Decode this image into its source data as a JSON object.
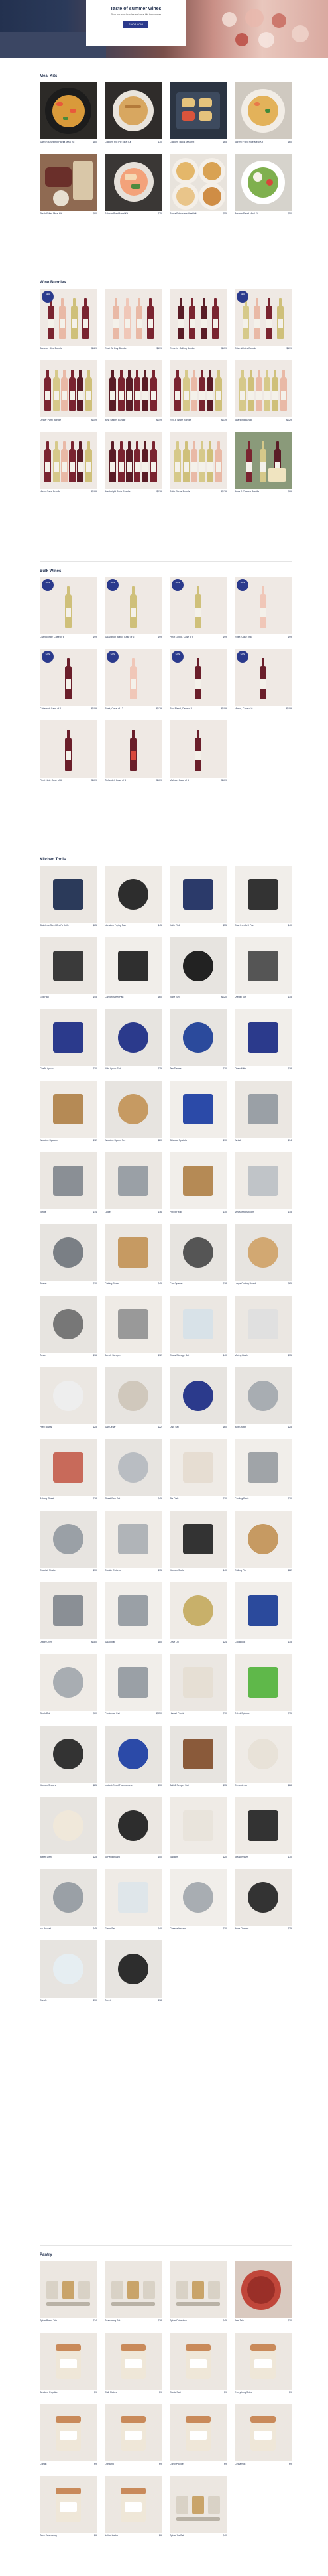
{
  "hero": {
    "title": "Taste of summer wines",
    "subtitle": "Shop our wine bundles and meal kits for summer",
    "button": "SHOP NOW"
  },
  "sections": [
    {
      "title": "Meal Kits",
      "items": [
        {
          "name": "Saffron & Shrimp Paella Meal Kit",
          "price": "$80",
          "sub": "",
          "img": "paella"
        },
        {
          "name": "Chicken Pot Pie Meal Kit",
          "price": "$70",
          "sub": "",
          "img": "potpie"
        },
        {
          "name": "Chicken Tacos Meal Kit",
          "price": "$65",
          "sub": "",
          "img": "tacos"
        },
        {
          "name": "Shrimp Fried Rice Meal Kit",
          "price": "$60",
          "sub": "",
          "img": "rice"
        },
        {
          "name": "Steak Frites Meal Kit",
          "price": "$90",
          "sub": "",
          "img": "steak"
        },
        {
          "name": "Salmon Bowl Meal Kit",
          "price": "$75",
          "sub": "",
          "img": "bowl"
        },
        {
          "name": "Pasta Primavera Meal Kit",
          "price": "$55",
          "sub": "",
          "img": "pasta"
        },
        {
          "name": "Burrata Salad Meal Kit",
          "price": "$50",
          "sub": "",
          "img": "salad"
        }
      ]
    },
    {
      "title": "Wine Bundles",
      "items": [
        {
          "name": "Summer Sips Bundle",
          "price": "$129",
          "sub": "",
          "img": "w4m",
          "badge": "NEW"
        },
        {
          "name": "Rosé All Day Bundle",
          "price": "$119",
          "sub": "",
          "img": "w4p"
        },
        {
          "name": "Reds for Grilling Bundle",
          "price": "$139",
          "sub": "",
          "img": "w4r"
        },
        {
          "name": "Crisp Whites Bundle",
          "price": "$119",
          "sub": "",
          "img": "w4w",
          "badge": "NEW"
        },
        {
          "name": "Dinner Party Bundle",
          "price": "$159",
          "sub": "",
          "img": "w6m"
        },
        {
          "name": "Best Sellers Bundle",
          "price": "$149",
          "sub": "",
          "img": "w6r"
        },
        {
          "name": "Red & White Bundle",
          "price": "$139",
          "sub": "",
          "img": "w6m"
        },
        {
          "name": "Sparkling Bundle",
          "price": "$129",
          "sub": "",
          "img": "w6w"
        },
        {
          "name": "Mixed Case Bundle",
          "price": "$199",
          "sub": "",
          "img": "w6m"
        },
        {
          "name": "Weeknight Reds Bundle",
          "price": "$119",
          "sub": "",
          "img": "w6r"
        },
        {
          "name": "Patio Pours Bundle",
          "price": "$129",
          "sub": "",
          "img": "w6w"
        },
        {
          "name": "Wine & Cheese Bundle",
          "price": "$99",
          "sub": "",
          "img": "w3m"
        }
      ]
    },
    {
      "title": "Bulk Wines",
      "items": [
        {
          "name": "Chardonnay, Case of 6",
          "price": "$99",
          "sub": "",
          "img": "b1w",
          "badge": "SAVE"
        },
        {
          "name": "Sauvignon Blanc, Case of 6",
          "price": "$99",
          "sub": "",
          "img": "b1w",
          "badge": "SAVE"
        },
        {
          "name": "Pinot Grigio, Case of 6",
          "price": "$99",
          "sub": "",
          "img": "b1w",
          "badge": "SAVE"
        },
        {
          "name": "Rosé, Case of 6",
          "price": "$99",
          "sub": "",
          "img": "b1p",
          "badge": "SAVE"
        },
        {
          "name": "Cabernet, Case of 6",
          "price": "$109",
          "sub": "",
          "img": "b1r",
          "badge": "SAVE"
        },
        {
          "name": "Rosé, Case of 12",
          "price": "$179",
          "sub": "",
          "img": "b1p",
          "badge": "SAVE"
        },
        {
          "name": "Red Blend, Case of 6",
          "price": "$109",
          "sub": "",
          "img": "b1r",
          "badge": "SAVE"
        },
        {
          "name": "Merlot, Case of 6",
          "price": "$109",
          "sub": "",
          "img": "b1r",
          "badge": "SAVE"
        },
        {
          "name": "Pinot Noir, Case of 6",
          "price": "$109",
          "sub": "",
          "img": "b1r"
        },
        {
          "name": "Zinfandel, Case of 6",
          "price": "$109",
          "sub": "",
          "img": "b1r2"
        },
        {
          "name": "Malbec, Case of 6",
          "price": "$109",
          "sub": "",
          "img": "b1r"
        }
      ]
    },
    {
      "title": "Kitchen Tools",
      "items": [
        {
          "name": "Stainless Steel Chef's Knife",
          "price": "$65",
          "sub": "",
          "img": "knife"
        },
        {
          "name": "Nonstick Frying Pan",
          "price": "$45",
          "sub": "",
          "img": "pan"
        },
        {
          "name": "Knife Roll",
          "price": "$55",
          "sub": "",
          "img": "roll"
        },
        {
          "name": "Cast Iron Grill Pan",
          "price": "$40",
          "sub": "",
          "img": "grillpan"
        },
        {
          "name": "Grill Pan",
          "price": "$45",
          "sub": "",
          "img": "sqpan"
        },
        {
          "name": "Carbon Steel Pan",
          "price": "$60",
          "sub": "",
          "img": "steelpan"
        },
        {
          "name": "Knife Set",
          "price": "$120",
          "sub": "",
          "img": "knives"
        },
        {
          "name": "Utensil Set",
          "price": "$35",
          "sub": "",
          "img": "utensils"
        },
        {
          "name": "Chef's Apron",
          "price": "$30",
          "sub": "",
          "img": "apron"
        },
        {
          "name": "Kids Apron Set",
          "price": "$25",
          "sub": "",
          "img": "apron2"
        },
        {
          "name": "Tea Towels",
          "price": "$20",
          "sub": "",
          "img": "towels"
        },
        {
          "name": "Oven Mitts",
          "price": "$18",
          "sub": "",
          "img": "mitt"
        },
        {
          "name": "Wooden Spatula",
          "price": "$12",
          "sub": "",
          "img": "spatula"
        },
        {
          "name": "Wooden Spoon Set",
          "price": "$20",
          "sub": "",
          "img": "spoons"
        },
        {
          "name": "Silicone Spatula",
          "price": "$10",
          "sub": "",
          "img": "bluespat"
        },
        {
          "name": "Whisk",
          "price": "$14",
          "sub": "",
          "img": "whisk"
        },
        {
          "name": "Tongs",
          "price": "$14",
          "sub": "",
          "img": "tongs"
        },
        {
          "name": "Ladle",
          "price": "$16",
          "sub": "",
          "img": "ladle"
        },
        {
          "name": "Pepper Mill",
          "price": "$30",
          "sub": "",
          "img": "mill"
        },
        {
          "name": "Measuring Spoons",
          "price": "$15",
          "sub": "",
          "img": "measure"
        },
        {
          "name": "Peeler",
          "price": "$10",
          "sub": "",
          "img": "peeler"
        },
        {
          "name": "Cutting Board",
          "price": "$45",
          "sub": "",
          "img": "board"
        },
        {
          "name": "Can Opener",
          "price": "$18",
          "sub": "",
          "img": "opener"
        },
        {
          "name": "Large Cutting Board",
          "price": "$65",
          "sub": "",
          "img": "board2"
        },
        {
          "name": "Zester",
          "price": "$16",
          "sub": "",
          "img": "zester"
        },
        {
          "name": "Bench Scraper",
          "price": "$12",
          "sub": "",
          "img": "scraper"
        },
        {
          "name": "Glass Storage Set",
          "price": "$40",
          "sub": "",
          "img": "glass"
        },
        {
          "name": "Mixing Bowls",
          "price": "$35",
          "sub": "",
          "img": "bowls"
        },
        {
          "name": "Prep Bowls",
          "price": "$25",
          "sub": "",
          "img": "prepbowls"
        },
        {
          "name": "Salt Cellar",
          "price": "$22",
          "sub": "",
          "img": "cellar"
        },
        {
          "name": "Dish Set",
          "price": "$60",
          "sub": "",
          "img": "dishes"
        },
        {
          "name": "Box Grater",
          "price": "$25",
          "sub": "",
          "img": "grater"
        },
        {
          "name": "Baking Sheet",
          "price": "$28",
          "sub": "",
          "img": "sheet"
        },
        {
          "name": "Sheet Pan Set",
          "price": "$45",
          "sub": "",
          "img": "sheet2"
        },
        {
          "name": "Pie Dish",
          "price": "$30",
          "sub": "",
          "img": "piedish"
        },
        {
          "name": "Cooling Rack",
          "price": "$20",
          "sub": "",
          "img": "rack"
        },
        {
          "name": "Cocktail Shaker",
          "price": "$30",
          "sub": "",
          "img": "shaker"
        },
        {
          "name": "Cookie Cutters",
          "price": "$15",
          "sub": "",
          "img": "cutters"
        },
        {
          "name": "Kitchen Scale",
          "price": "$40",
          "sub": "",
          "img": "scale"
        },
        {
          "name": "Rolling Pin",
          "price": "$22",
          "sub": "",
          "img": "pin"
        },
        {
          "name": "Dutch Oven",
          "price": "$180",
          "sub": "",
          "img": "dutch"
        },
        {
          "name": "Saucepan",
          "price": "$80",
          "sub": "",
          "img": "saucepan"
        },
        {
          "name": "Olive Oil",
          "price": "$24",
          "sub": "",
          "img": "oil"
        },
        {
          "name": "Cookbook",
          "price": "$35",
          "sub": "",
          "img": "book"
        },
        {
          "name": "Stock Pot",
          "price": "$90",
          "sub": "",
          "img": "pot"
        },
        {
          "name": "Cookware Set",
          "price": "$350",
          "sub": "",
          "img": "cookware"
        },
        {
          "name": "Utensil Crock",
          "price": "$30",
          "sub": "",
          "img": "crock"
        },
        {
          "name": "Salad Spinner",
          "price": "$35",
          "sub": "",
          "img": "spinner"
        },
        {
          "name": "Kitchen Shears",
          "price": "$25",
          "sub": "",
          "img": "shears"
        },
        {
          "name": "Instant-Read Thermometer",
          "price": "$30",
          "sub": "",
          "img": "thermo"
        },
        {
          "name": "Salt & Pepper Set",
          "price": "$35",
          "sub": "",
          "img": "saltpepper"
        },
        {
          "name": "Ceramic Jar",
          "price": "$28",
          "sub": "",
          "img": "jar"
        },
        {
          "name": "Butter Dish",
          "price": "$25",
          "sub": "",
          "img": "butter"
        },
        {
          "name": "Serving Board",
          "price": "$50",
          "sub": "",
          "img": "servboard"
        },
        {
          "name": "Napkins",
          "price": "$20",
          "sub": "",
          "img": "napkins"
        },
        {
          "name": "Steak Knives",
          "price": "$70",
          "sub": "",
          "img": "steakknives"
        },
        {
          "name": "Ice Bucket",
          "price": "$45",
          "sub": "",
          "img": "bucket"
        },
        {
          "name": "Glass Set",
          "price": "$40",
          "sub": "",
          "img": "glasses"
        },
        {
          "name": "Cheese Knives",
          "price": "$30",
          "sub": "",
          "img": "cheeseknives"
        },
        {
          "name": "Wine Opener",
          "price": "$25",
          "sub": "",
          "img": "corkscrew"
        },
        {
          "name": "Carafe",
          "price": "$30",
          "sub": "",
          "img": "carafe"
        },
        {
          "name": "Trivet",
          "price": "$18",
          "sub": "",
          "img": "trivet"
        }
      ]
    },
    {
      "title": "Pantry",
      "items": [
        {
          "name": "Spice Blend Trio",
          "price": "$24",
          "sub": "",
          "img": "spices"
        },
        {
          "name": "Seasoning Set",
          "price": "$28",
          "sub": "",
          "img": "spices2"
        },
        {
          "name": "Spice Collection",
          "price": "$45",
          "sub": "",
          "img": "spices3"
        },
        {
          "name": "Jam Trio",
          "price": "$30",
          "sub": "",
          "img": "jam"
        },
        {
          "name": "Smoked Paprika",
          "price": "$9",
          "sub": "",
          "img": "tin"
        },
        {
          "name": "Chili Flakes",
          "price": "$9",
          "sub": "",
          "img": "tin"
        },
        {
          "name": "Garlic Salt",
          "price": "$9",
          "sub": "",
          "img": "tin"
        },
        {
          "name": "Everything Spice",
          "price": "$9",
          "sub": "",
          "img": "tin"
        },
        {
          "name": "Cumin",
          "price": "$9",
          "sub": "",
          "img": "tin"
        },
        {
          "name": "Oregano",
          "price": "$9",
          "sub": "",
          "img": "tin"
        },
        {
          "name": "Curry Powder",
          "price": "$9",
          "sub": "",
          "img": "tin"
        },
        {
          "name": "Cinnamon",
          "price": "$9",
          "sub": "",
          "img": "tin"
        },
        {
          "name": "Taco Seasoning",
          "price": "$9",
          "sub": "",
          "img": "tin"
        },
        {
          "name": "Italian Herbs",
          "price": "$9",
          "sub": "",
          "img": "tin"
        },
        {
          "name": "Spice Jar Set",
          "price": "$40",
          "sub": "",
          "img": "jarset"
        }
      ]
    }
  ]
}
